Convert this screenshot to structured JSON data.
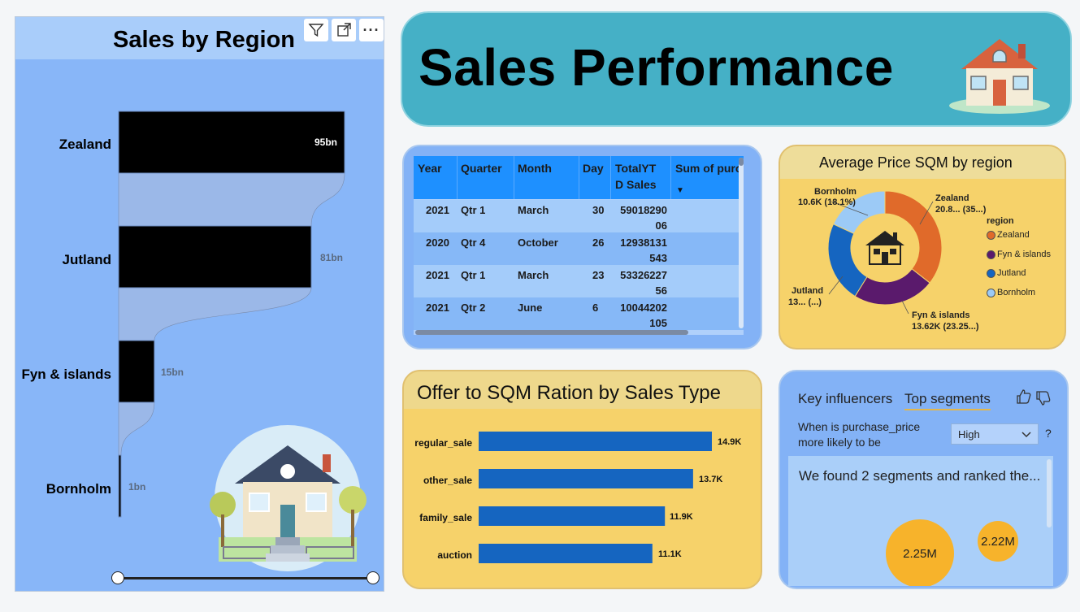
{
  "colors": {
    "bar_primary": "#000000",
    "bar_fill_connector": "#9bb8e8",
    "table_header": "#1e90ff",
    "zealand": "#e06a2a",
    "fyn_islands": "#5a1a6c",
    "jutland": "#1565c0",
    "bornholm": "#9ccaf6",
    "hbar": "#1565c0",
    "bubble": "#f7b32b"
  },
  "funnel": {
    "title": "Sales by Region",
    "toolbar_icons": [
      "filter-icon",
      "focus-mode-icon",
      "more-options-icon"
    ],
    "more_label": "···",
    "chart_data": {
      "type": "bar",
      "orientation": "horizontal-funnel",
      "categories": [
        "Zealand",
        "Jutland",
        "Fyn & islands",
        "Bornholm"
      ],
      "values": [
        95,
        81,
        15,
        1
      ],
      "value_labels": [
        "95bn",
        "81bn",
        "15bn",
        "1bn"
      ],
      "title": "Sales by Region"
    },
    "slider": {
      "start": 0,
      "end": 1
    }
  },
  "header": {
    "title": "Sales Performance"
  },
  "table": {
    "columns": [
      "Year",
      "Quarter",
      "Month",
      "Day",
      "TotalYT D Sales",
      "Sum of purc"
    ],
    "sort_indicator": "▼",
    "rows": [
      {
        "year": "2021",
        "quarter": "Qtr 1",
        "month": "March",
        "day": "30",
        "sales_line1": "59018290",
        "sales_line2": "06"
      },
      {
        "year": "2020",
        "quarter": "Qtr 4",
        "month": "October",
        "day": "26",
        "sales_line1": "12938131",
        "sales_line2": "543"
      },
      {
        "year": "2021",
        "quarter": "Qtr 1",
        "month": "March",
        "day": "23",
        "sales_line1": "53326227",
        "sales_line2": "56"
      },
      {
        "year": "2021",
        "quarter": "Qtr 2",
        "month": "June",
        "day": "6",
        "sales_line1": "10044202",
        "sales_line2": "105"
      }
    ]
  },
  "donut": {
    "title": "Average Price SQM by region",
    "legend_title": "region",
    "labels": {
      "bornholm_name": "Bornholm",
      "bornholm_value": "10.6K (18.1%)",
      "zealand_name": "Zealand",
      "zealand_value": "20.8... (35...)",
      "jutland_name": "Jutland",
      "jutland_value": "13... (...)",
      "fyn_name": "Fyn & islands",
      "fyn_value": "13.62K (23.25...)"
    },
    "legend": [
      "Zealand",
      "Fyn & islands",
      "Jutland",
      "Bornholm"
    ],
    "chart_data": {
      "type": "pie",
      "categories": [
        "Zealand",
        "Fyn & islands",
        "Jutland",
        "Bornholm"
      ],
      "values": [
        20.8,
        13.62,
        13.5,
        10.6
      ],
      "percent": [
        35.5,
        23.25,
        23.1,
        18.1
      ],
      "title": "Average Price SQM by region"
    }
  },
  "hbar": {
    "title": "Offer to SQM Ration by Sales Type",
    "chart_data": {
      "type": "bar",
      "orientation": "horizontal",
      "categories": [
        "regular_sale",
        "other_sale",
        "family_sale",
        "auction"
      ],
      "values": [
        14.9,
        13.7,
        11.9,
        11.1
      ],
      "value_labels": [
        "14.9K",
        "13.7K",
        "11.9K",
        "11.1K"
      ],
      "title": "Offer to SQM Ration by Sales Type"
    }
  },
  "key_influencers": {
    "tab_key": "Key influencers",
    "tab_top": "Top segments",
    "question": "When is purchase_price more likely to be",
    "selected_value": "High",
    "help": "?",
    "found_text": "We found 2 segments and ranked the...",
    "segments": [
      {
        "label": "2.25M",
        "value": 2.25
      },
      {
        "label": "2.22M",
        "value": 2.22
      }
    ]
  }
}
